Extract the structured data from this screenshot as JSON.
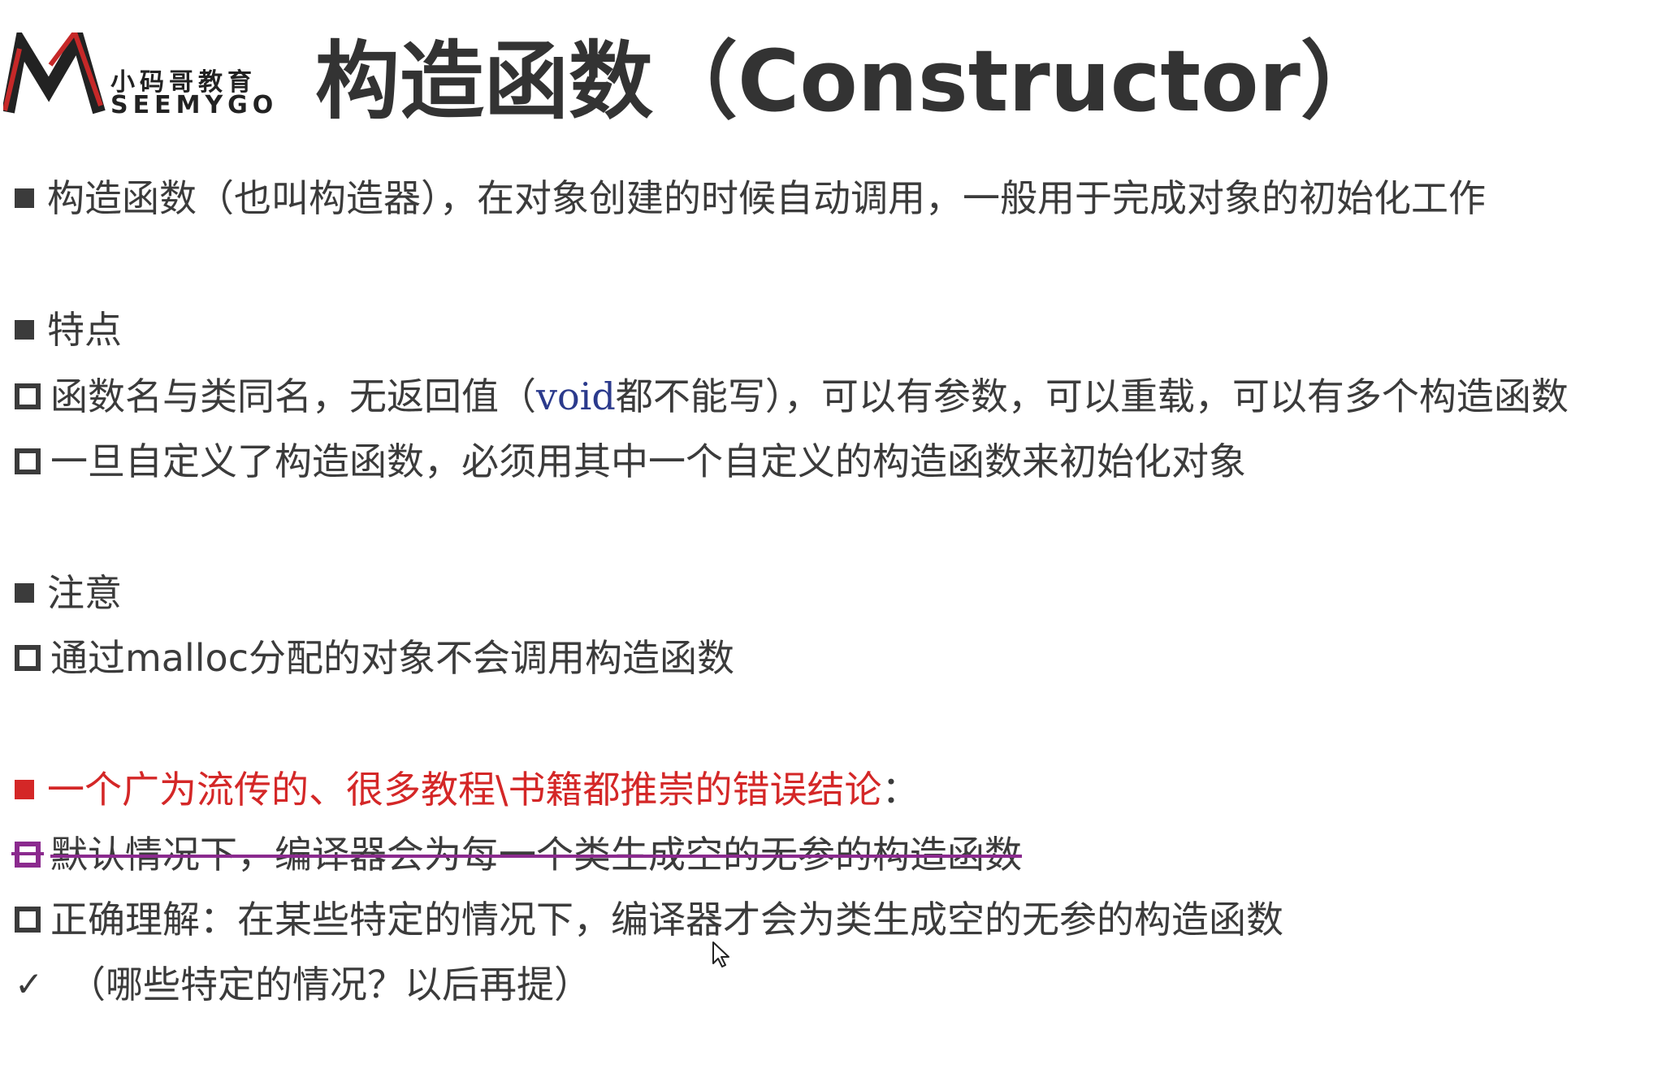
{
  "header": {
    "logo_cn": "小码哥教育",
    "logo_en": "SEEMYGO",
    "title": "构造函数（Constructor）"
  },
  "lines": {
    "l1": "构造函数（也叫构造器），在对象创建的时候自动调用，一般用于完成对象的初始化工作",
    "features_heading": "特点",
    "f1_a": "函数名与类同名，无返回值（",
    "f1_code": "void",
    "f1_b": "都不能写），可以有参数，可以重载，可以有多个构造函数",
    "f2": "一旦自定义了构造函数，必须用其中一个自定义的构造函数来初始化对象",
    "notes_heading": "注意",
    "n1": "通过malloc分配的对象不会调用构造函数",
    "wrong_heading": "一个广为流传的、很多教程\\书籍都推崇的错误结论",
    "wrong_colon": "：",
    "w1": "默认情况下，编译器会为每一个类生成空的无参的构造函数",
    "w2": "正确理解：在某些特定的情况下，编译器才会为类生成空的无参的构造函数",
    "w3": "（哪些特定的情况？以后再提）"
  },
  "icons": {
    "filled": "filled-square-bullet-icon",
    "hollow": "hollow-square-bullet-icon",
    "check": "check-icon",
    "cursor": "mouse-cursor-icon"
  },
  "colors": {
    "text": "#3b3b3b",
    "red": "#d42727",
    "purple": "#8b2a8e",
    "code": "#2b3a8c"
  }
}
